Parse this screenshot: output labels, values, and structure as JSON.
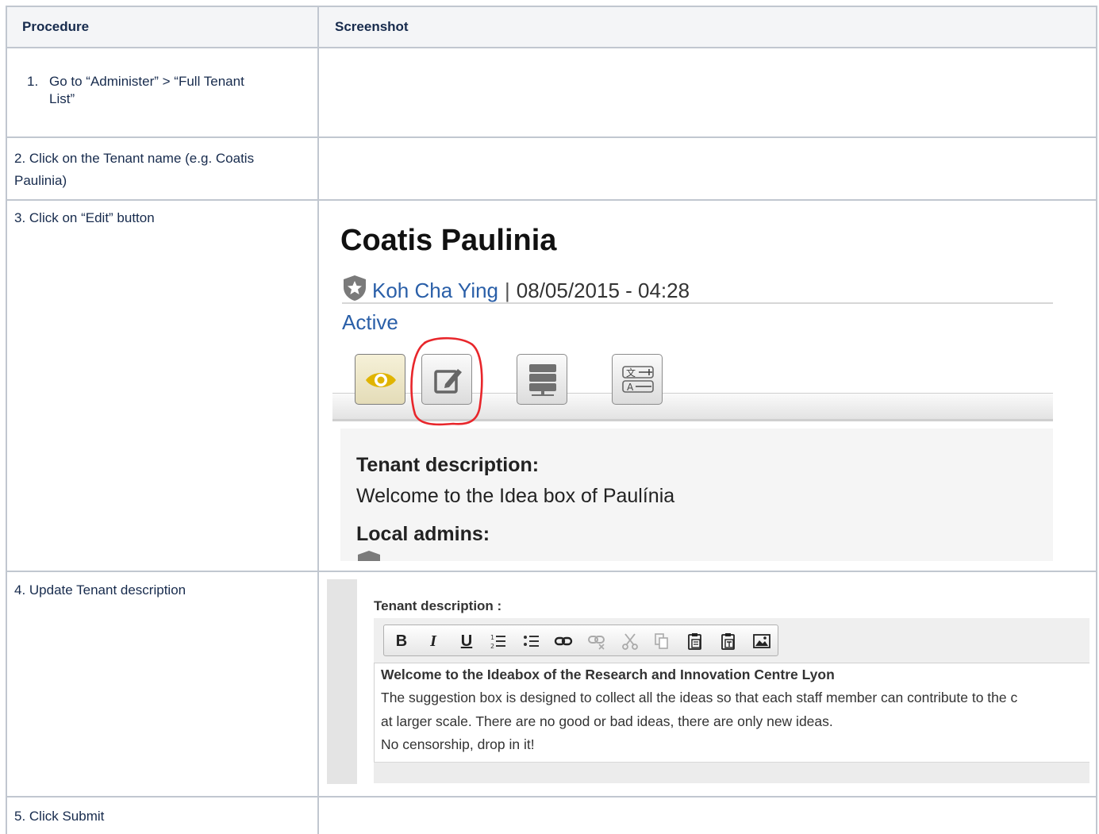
{
  "table": {
    "headers": {
      "procedure": "Procedure",
      "screenshot": "Screenshot"
    },
    "rows": [
      {
        "step_num": "1.",
        "step_text": "Go to “Administer” > “Full Tenant",
        "step_text2": "List”"
      },
      {
        "step_text": "2. Click on the Tenant name (e.g.  Coatis",
        "step_text2": "Paulinia)"
      },
      {
        "step_text": "3. Click on “Edit” button"
      },
      {
        "step_text": "4. Update Tenant description"
      },
      {
        "step_text": "5. Click Submit"
      }
    ]
  },
  "shot1": {
    "title": "Coatis Paulinia",
    "author": "Koh Cha Ying",
    "separator": "|",
    "datetime": "08/05/2015 - 04:28",
    "status": "Active",
    "desc_heading": "Tenant description:",
    "desc_text": "Welcome to the Idea box of Paulínia",
    "admins_heading": "Local admins:",
    "highlight_color": "#e8262b",
    "link_color": "#2a5fa8"
  },
  "shot2": {
    "label": "Tenant description :",
    "toolbar": [
      "bold",
      "italic",
      "underline",
      "numbered-list",
      "bulleted-list",
      "link",
      "unlink",
      "cut",
      "copy",
      "paste",
      "paste-text",
      "image"
    ],
    "toolbar_glyphs": {
      "bold": "B",
      "italic": "I",
      "underline": "U"
    },
    "content_title": "Welcome to the Ideabox of the Research and Innovation Centre Lyon",
    "content_line1": "The suggestion box is designed to collect all the ideas so that each staff member can contribute to the c",
    "content_line2": "at larger scale. There are no good or bad ideas, there are only new ideas.",
    "content_line3": "No censorship, drop in it!"
  }
}
